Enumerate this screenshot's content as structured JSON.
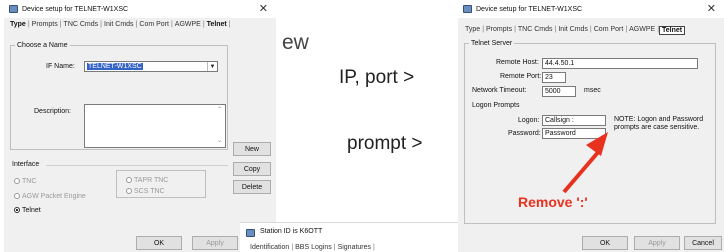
{
  "left_dialog": {
    "title": "Device setup for TELNET-W1XSC",
    "tabs": [
      "Type",
      "Prompts",
      "TNC Cmds",
      "Init Cmds",
      "Com Port",
      "AGWPE",
      "Telnet"
    ],
    "choose_group": "Choose a Name",
    "if_name_label": "IF Name:",
    "if_name_value": "TELNET-W1XSC",
    "description_label": "Description:",
    "interface_group": "Interface",
    "radios": {
      "tnc": "TNC",
      "agw": "AGW Packet Engine",
      "telnet": "Telnet",
      "tapr": "TAPR TNC",
      "scs": "SCS TNC"
    },
    "buttons": {
      "new": "New",
      "copy": "Copy",
      "delete": "Delete"
    },
    "ok": "OK",
    "apply": "Apply"
  },
  "background_text": "ew",
  "captions": {
    "ip_port": "IP, port >",
    "prompt": "prompt >"
  },
  "right_dialog": {
    "title": "Device setup for TELNET-W1XSC",
    "tabs": [
      "Type",
      "Prompts",
      "TNC Cmds",
      "Init Cmds",
      "Com Port",
      "AGWPE",
      "Telnet"
    ],
    "server_group": "Telnet Server",
    "remote_host_label": "Remote Host:",
    "remote_host_value": "44.4.50.1",
    "remote_port_label": "Remote Port:",
    "remote_port_value": "23",
    "timeout_label": "Network Timeout:",
    "timeout_value": "5000",
    "timeout_unit": "msec",
    "logon_prompts_label": "Logon Prompts",
    "logon_label": "Logon:",
    "logon_value": "Callsign :",
    "password_label": "Password:",
    "password_value": "Password",
    "note": "NOTE: Logon and Password prompts are case sensitive.",
    "remove_annotation": "Remove ':'",
    "ok": "OK",
    "apply": "Apply",
    "cancel": "Cancel"
  },
  "station_dialog": {
    "title": "Station ID is K6OTT",
    "tabs": [
      "Identification",
      "BBS Logins",
      "Signatures"
    ]
  },
  "colors": {
    "arrow": "#e8321f",
    "selection": "#3363c7"
  }
}
